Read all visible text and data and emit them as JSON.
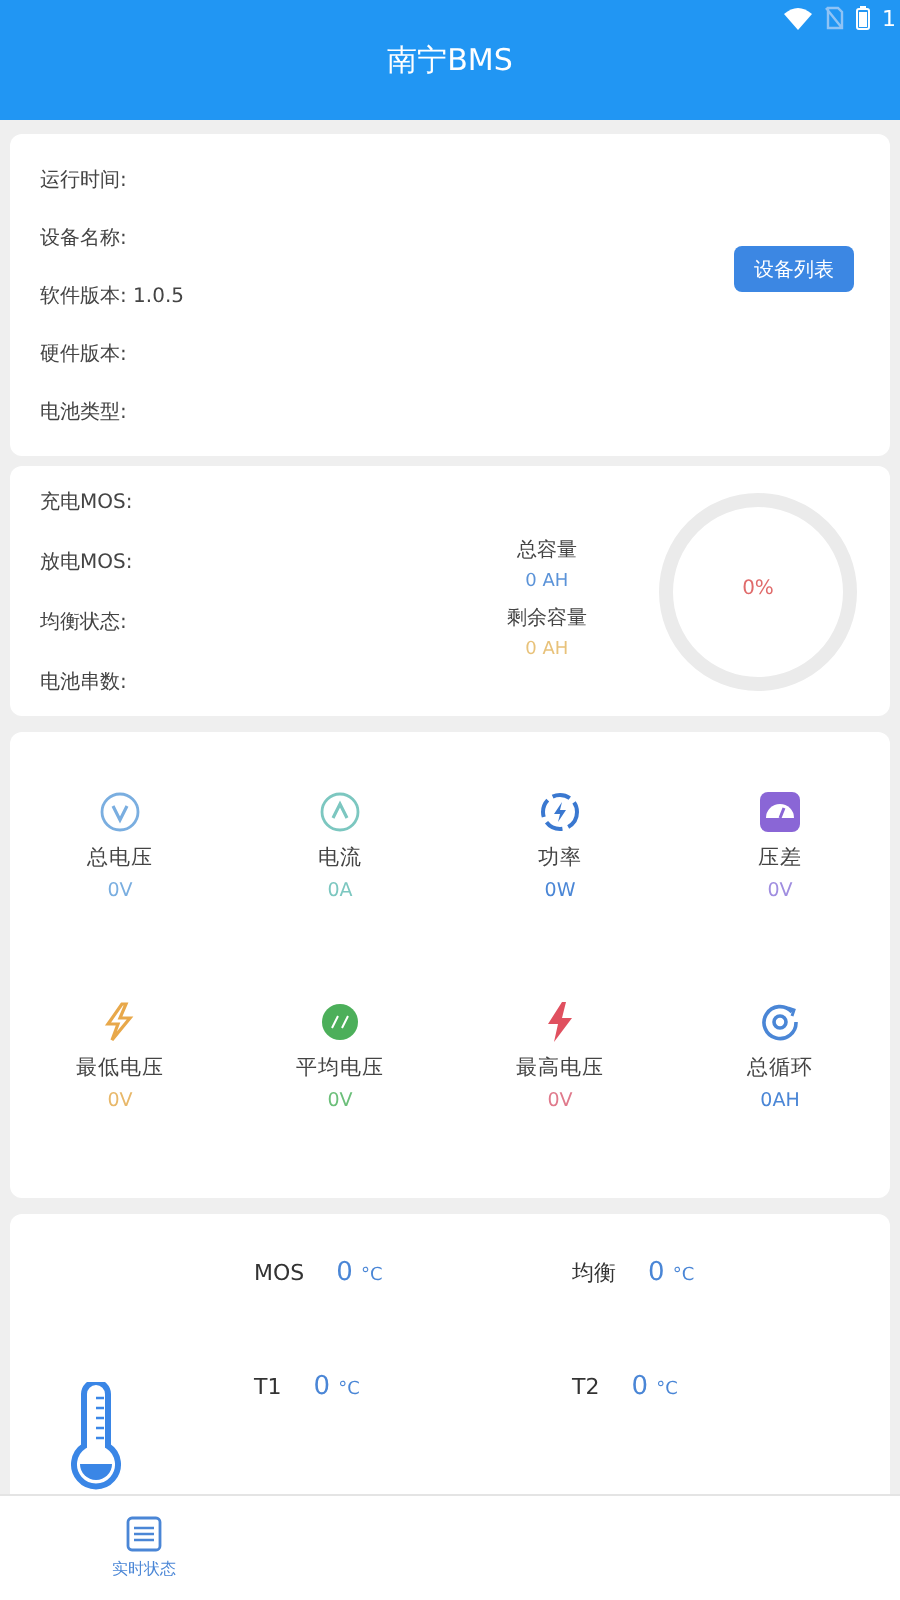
{
  "status_bar": {
    "battery_text": "1"
  },
  "app_bar": {
    "title": "南宁BMS"
  },
  "device_info": {
    "fields": [
      {
        "label": "运行时间:"
      },
      {
        "label": "设备名称:"
      },
      {
        "label": "软件版本:",
        "value": "1.0.5"
      },
      {
        "label": "硬件版本:"
      },
      {
        "label": "电池类型:"
      }
    ],
    "button": "设备列表"
  },
  "battery_status": {
    "fields": [
      "充电MOS:",
      "放电MOS:",
      "均衡状态:",
      "电池串数:"
    ],
    "capacities": [
      {
        "label": "总容量",
        "value": "0 AH",
        "color": "#5b93d8"
      },
      {
        "label": "剩余容量",
        "value": "0 AH",
        "color": "#e8c27a"
      }
    ],
    "gauge": {
      "text": "0%"
    }
  },
  "metrics": [
    {
      "label": "总电压",
      "value": "0V",
      "color": "#7aaee0"
    },
    {
      "label": "电流",
      "value": "0A",
      "color": "#7cc7c0"
    },
    {
      "label": "功率",
      "value": "0W",
      "color": "#4a86d6"
    },
    {
      "label": "压差",
      "value": "0V",
      "color": "#a08ee0"
    },
    {
      "label": "最低电压",
      "value": "0V",
      "color": "#e8b86a"
    },
    {
      "label": "平均电压",
      "value": "0V",
      "color": "#6cbf7a"
    },
    {
      "label": "最高电压",
      "value": "0V",
      "color": "#e07a8c"
    },
    {
      "label": "总循环",
      "value": "0AH",
      "color": "#4a86d6"
    }
  ],
  "temperatures": [
    {
      "label": "MOS",
      "value": "0",
      "unit": "°C"
    },
    {
      "label": "均衡",
      "value": "0",
      "unit": "°C"
    },
    {
      "label": "T1",
      "value": "0",
      "unit": "°C"
    },
    {
      "label": "T2",
      "value": "0",
      "unit": "°C"
    }
  ],
  "bottom_nav": [
    {
      "label": "实时状态",
      "selected": true
    }
  ]
}
